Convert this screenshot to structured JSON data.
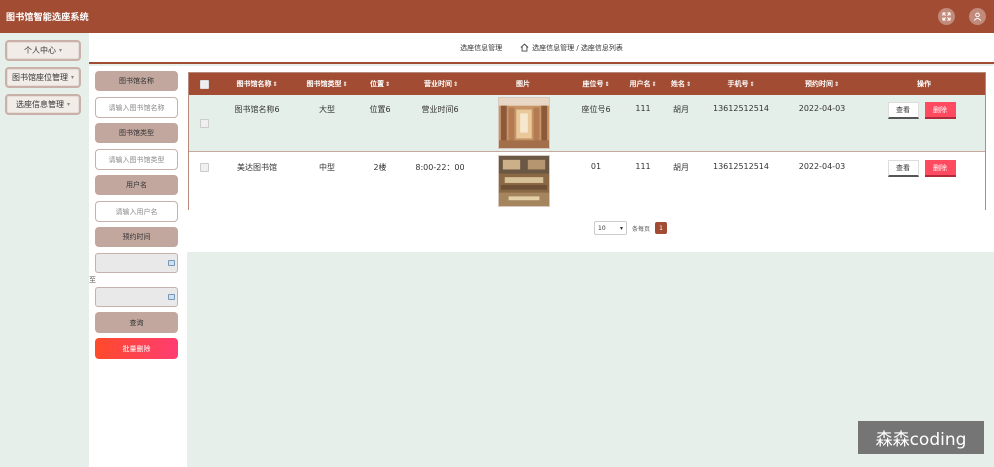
{
  "app": {
    "title": "图书馆智能选座系统"
  },
  "header_icons": [
    {
      "name": "fullscreen-icon",
      "glyph": "⤧"
    },
    {
      "name": "user-avatar-icon",
      "glyph": "☺"
    }
  ],
  "sidebar": {
    "items": [
      {
        "label": "个人中心"
      },
      {
        "label": "图书馆座位管理"
      },
      {
        "label": "选座信息管理"
      }
    ]
  },
  "breadcrumb": {
    "section": "选座信息管理",
    "path": "选座信息管理 / 选座信息列表"
  },
  "filters": {
    "library_name_label": "图书馆名称",
    "library_name_placeholder": "请输入图书馆名称",
    "library_type_label": "图书馆类型",
    "library_type_placeholder": "请输入图书馆类型",
    "username_label": "用户名",
    "username_placeholder": "请输入用户名",
    "reserve_time_label": "预约时间",
    "to_label": "至",
    "query_button": "查询",
    "batch_delete_button": "批量删除"
  },
  "table": {
    "headers": [
      "图书馆名称",
      "图书馆类型",
      "位置",
      "营业时间",
      "图片",
      "座位号",
      "用户名",
      "姓名",
      "手机号",
      "预约时间",
      "操作"
    ],
    "sortable": [
      true,
      true,
      true,
      true,
      false,
      true,
      true,
      true,
      true,
      true,
      false
    ],
    "rows": [
      {
        "library_name": "图书馆名称6",
        "library_type": "大型",
        "location": "位置6",
        "hours": "营业时间6",
        "image": "library-hall-image",
        "seat": "座位号6",
        "username": "111",
        "name": "胡月",
        "phone": "13612512514",
        "reserve_time": "2022-04-03"
      },
      {
        "library_name": "美达图书馆",
        "library_type": "中型",
        "location": "2楼",
        "hours": "8:00-22：00",
        "image": "reading-room-image",
        "seat": "01",
        "username": "111",
        "name": "胡月",
        "phone": "13612512514",
        "reserve_time": "2022-04-03"
      }
    ],
    "view_button": "查看",
    "delete_button": "删除"
  },
  "pagination": {
    "page_size": "10",
    "per_page_label": "条每页",
    "current_page": "1"
  },
  "watermark": "森森coding",
  "colors": {
    "brand": "#a14c33",
    "page_bg": "#e6efea",
    "delete": "#ff4a60"
  }
}
